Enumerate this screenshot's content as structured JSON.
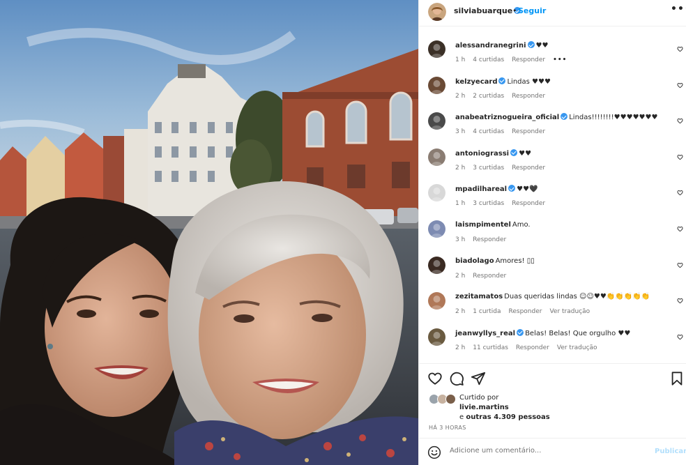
{
  "header": {
    "username": "silviabuarque",
    "dot": "•",
    "follow": "Seguir",
    "more": "•••"
  },
  "comments": [
    {
      "user": "alessandranegrini",
      "verified": true,
      "text": "♥♥",
      "time": "1 h",
      "likes": "4 curtidas",
      "reply": "Responder",
      "translate": "",
      "more": "•••",
      "avatar_color": "#3b3027"
    },
    {
      "user": "kelzyecard",
      "verified": true,
      "text": "Lindas ♥♥♥",
      "time": "2 h",
      "likes": "2 curtidas",
      "reply": "Responder",
      "translate": "",
      "more": "",
      "avatar_color": "#6a4a35"
    },
    {
      "user": "anabeatriznogueira_oficial",
      "verified": true,
      "text": "Lindas!!!!!!!!♥♥♥♥♥♥♥",
      "time": "3 h",
      "likes": "4 curtidas",
      "reply": "Responder",
      "translate": "",
      "more": "",
      "avatar_color": "#4a4a4a"
    },
    {
      "user": "antoniograssi",
      "verified": true,
      "text": "♥♥",
      "time": "2 h",
      "likes": "3 curtidas",
      "reply": "Responder",
      "translate": "",
      "more": "",
      "avatar_color": "#8a7c72"
    },
    {
      "user": "mpadilhareal",
      "verified": true,
      "text": "♥♥🖤",
      "time": "1 h",
      "likes": "3 curtidas",
      "reply": "Responder",
      "translate": "",
      "more": "",
      "avatar_color": "#d8d8d8"
    },
    {
      "user": "laismpimentel",
      "verified": false,
      "text": "Amo.",
      "time": "3 h",
      "likes": "",
      "reply": "Responder",
      "translate": "",
      "more": "",
      "avatar_color": "#7d8bb2"
    },
    {
      "user": "biadolago",
      "verified": false,
      "text": "Amores! ▯▯",
      "time": "2 h",
      "likes": "",
      "reply": "Responder",
      "translate": "",
      "more": "",
      "avatar_color": "#3a2a22"
    },
    {
      "user": "zezitamatos",
      "verified": false,
      "text": "Duas queridas lindas ☺☺♥♥👏👏👏👏👏",
      "time": "2 h",
      "likes": "1 curtida",
      "reply": "Responder",
      "translate": "Ver tradução",
      "more": "",
      "avatar_color": "#b07858"
    },
    {
      "user": "jeanwyllys_real",
      "verified": true,
      "text": "Belas! Belas! Que orgulho ♥♥",
      "time": "2 h",
      "likes": "11 curtidas",
      "reply": "Responder",
      "translate": "Ver tradução",
      "more": "",
      "avatar_color": "#6a5a40"
    }
  ],
  "likes": {
    "prefix": "Curtido por",
    "user": "livie.martins",
    "and": "e",
    "others": "outras 4.309 pessoas"
  },
  "time_ago": "HÁ 3 HORAS",
  "add_comment": {
    "placeholder": "Adicione um comentário...",
    "publish": "Publicar"
  },
  "icons": {
    "like": "heart-icon",
    "comment": "comment-icon",
    "share": "share-icon",
    "save": "bookmark-icon",
    "emoji": "emoji-icon"
  },
  "colors": {
    "accent": "#0095f6",
    "verified": "#3797f0",
    "muted": "#737373",
    "publish_disabled": "#b2dffc"
  }
}
